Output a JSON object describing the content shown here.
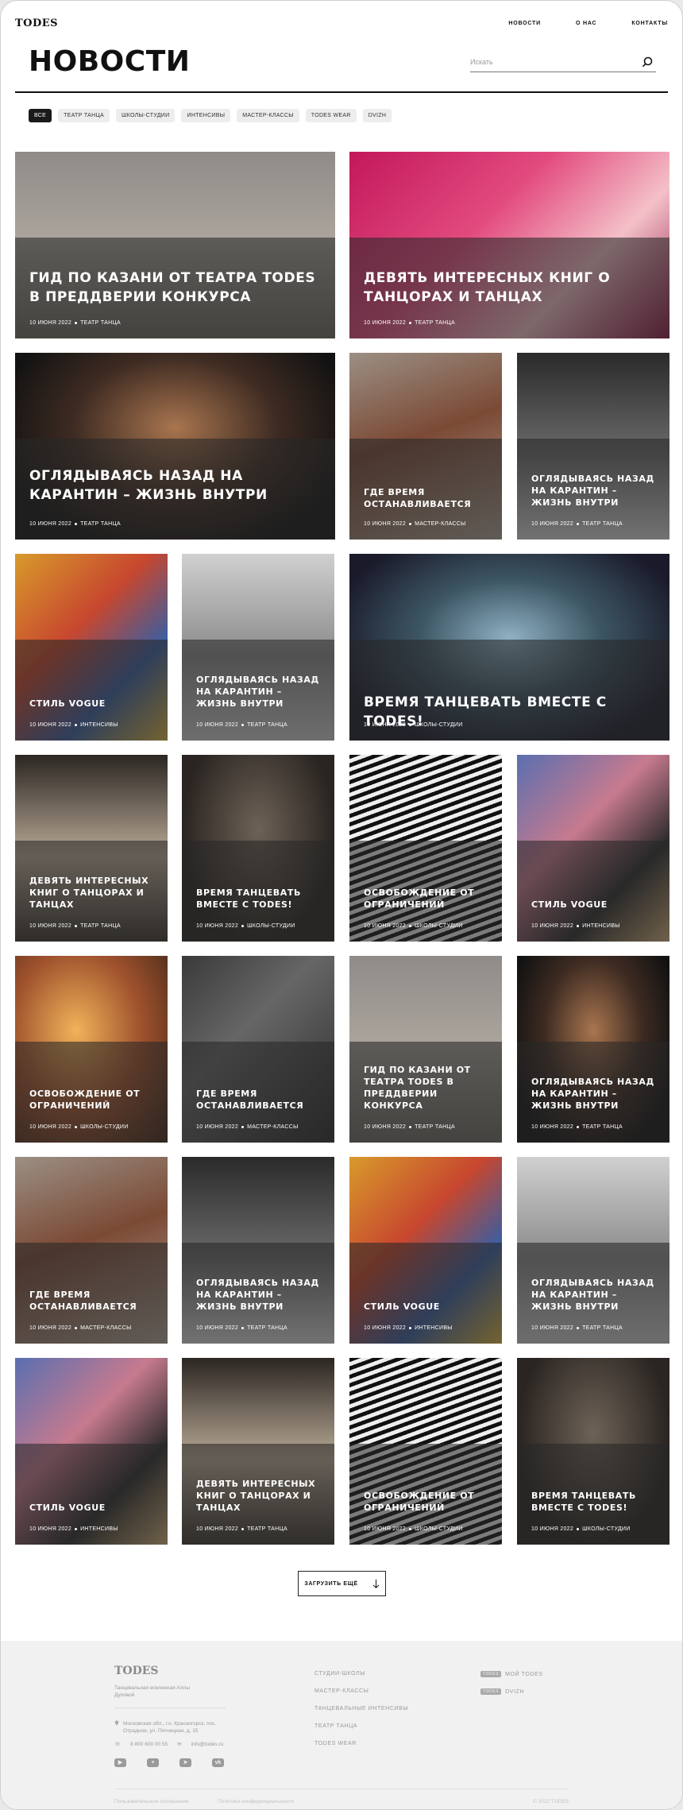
{
  "header": {
    "logo": "TODES",
    "nav": [
      "НОВОСТИ",
      "О НАС",
      "КОНТАКТЫ"
    ]
  },
  "page": {
    "title": "НОВОСТИ",
    "search_placeholder": "Искать"
  },
  "filters": [
    "ВСЕ",
    "ТЕАТР ТАНЦА",
    "ШКОЛЫ-СТУДИИ",
    "ИНТЕНСИВЫ",
    "МАСТЕР-КЛАССЫ",
    "TODES WEAR",
    "DVIZH"
  ],
  "cards": [
    {
      "title": "ГИД ПО КАЗАНИ ОТ ТЕАТРА TODES В ПРЕДДВЕРИИ КОНКУРСА",
      "date": "10 ИЮНЯ 2022",
      "category": "ТЕАТР ТАНЦА"
    },
    {
      "title": "ДЕВЯТЬ ИНТЕРЕСНЫХ КНИГ О ТАНЦОРАХ И ТАНЦАХ",
      "date": "10 ИЮНЯ 2022",
      "category": "ТЕАТР ТАНЦА"
    },
    {
      "title": "ОГЛЯДЫВАЯСЬ НАЗАД НА КАРАНТИН – ЖИЗНЬ ВНУТРИ",
      "date": "10 ИЮНЯ 2022",
      "category": "ТЕАТР ТАНЦА"
    },
    {
      "title": "ГДЕ ВРЕМЯ ОСТАНАВЛИВАЕТСЯ",
      "date": "10 ИЮНЯ 2022",
      "category": "МАСТЕР-КЛАССЫ"
    },
    {
      "title": "ОГЛЯДЫВАЯСЬ НАЗАД НА КАРАНТИН – ЖИЗНЬ ВНУТРИ",
      "date": "10 ИЮНЯ 2022",
      "category": "ТЕАТР ТАНЦА"
    },
    {
      "title": "СТИЛЬ VOGUE",
      "date": "10 ИЮНЯ 2022",
      "category": "ИНТЕНСИВЫ"
    },
    {
      "title": "ОГЛЯДЫВАЯСЬ НАЗАД НА КАРАНТИН – ЖИЗНЬ ВНУТРИ",
      "date": "10 ИЮНЯ 2022",
      "category": "ТЕАТР ТАНЦА"
    },
    {
      "title": "ВРЕМЯ ТАНЦЕВАТЬ ВМЕСТЕ С TODES!",
      "date": "10 ИЮНЯ 2022",
      "category": "ШКОЛЫ-СТУДИИ"
    },
    {
      "title": "ДЕВЯТЬ ИНТЕРЕСНЫХ КНИГ О ТАНЦОРАХ И ТАНЦАХ",
      "date": "10 ИЮНЯ 2022",
      "category": "ТЕАТР ТАНЦА"
    },
    {
      "title": "ВРЕМЯ ТАНЦЕВАТЬ ВМЕСТЕ С TODES!",
      "date": "10 ИЮНЯ 2022",
      "category": "ШКОЛЫ-СТУДИИ"
    },
    {
      "title": "ОСВОБОЖДЕНИЕ ОТ ОГРАНИЧЕНИЙ",
      "date": "10 ИЮНЯ 2022",
      "category": "ШКОЛЫ-СТУДИИ"
    },
    {
      "title": "СТИЛЬ VOGUE",
      "date": "10 ИЮНЯ 2022",
      "category": "ИНТЕНСИВЫ"
    },
    {
      "title": "ОСВОБОЖДЕНИЕ ОТ ОГРАНИЧЕНИЙ",
      "date": "10 ИЮНЯ 2022",
      "category": "ШКОЛЫ-СТУДИИ"
    },
    {
      "title": "ГДЕ ВРЕМЯ ОСТАНАВЛИВАЕТСЯ",
      "date": "10 ИЮНЯ 2022",
      "category": "МАСТЕР-КЛАССЫ"
    },
    {
      "title": "ГИД ПО КАЗАНИ ОТ ТЕАТРА TODES В ПРЕДДВЕРИИ КОНКУРСА",
      "date": "10 ИЮНЯ 2022",
      "category": "ТЕАТР ТАНЦА"
    },
    {
      "title": "ОГЛЯДЫВАЯСЬ НАЗАД НА КАРАНТИН – ЖИЗНЬ ВНУТРИ",
      "date": "10 ИЮНЯ 2022",
      "category": "ТЕАТР ТАНЦА"
    },
    {
      "title": "ГДЕ ВРЕМЯ ОСТАНАВЛИВАЕТСЯ",
      "date": "10 ИЮНЯ 2022",
      "category": "МАСТЕР-КЛАССЫ"
    },
    {
      "title": "ОГЛЯДЫВАЯСЬ НАЗАД НА КАРАНТИН – ЖИЗНЬ ВНУТРИ",
      "date": "10 ИЮНЯ 2022",
      "category": "ТЕАТР ТАНЦА"
    },
    {
      "title": "СТИЛЬ VOGUE",
      "date": "10 ИЮНЯ 2022",
      "category": "ИНТЕНСИВЫ"
    },
    {
      "title": "ОГЛЯДЫВАЯСЬ НАЗАД НА КАРАНТИН – ЖИЗНЬ ВНУТРИ",
      "date": "10 ИЮНЯ 2022",
      "category": "ТЕАТР ТАНЦА"
    },
    {
      "title": "СТИЛЬ VOGUE",
      "date": "10 ИЮНЯ 2022",
      "category": "ИНТЕНСИВЫ"
    },
    {
      "title": "ДЕВЯТЬ ИНТЕРЕСНЫХ КНИГ О ТАНЦОРАХ И ТАНЦАХ",
      "date": "10 ИЮНЯ 2022",
      "category": "ТЕАТР ТАНЦА"
    },
    {
      "title": "ОСВОБОЖДЕНИЕ ОТ ОГРАНИЧЕНИЙ",
      "date": "10 ИЮНЯ 2022",
      "category": "ШКОЛЫ-СТУДИИ"
    },
    {
      "title": "ВРЕМЯ ТАНЦЕВАТЬ ВМЕСТЕ С TODES!",
      "date": "10 ИЮНЯ 2022",
      "category": "ШКОЛЫ-СТУДИИ"
    }
  ],
  "load_more": "ЗАГРУЗИТЬ ЕЩЁ",
  "footer": {
    "logo": "TODES",
    "tagline": "Танцевальная вселенная Аллы Духовой",
    "address": "Московская обл., г.о. Красногорск, пос. Отрадное, ул. Пятницкая, д. 15",
    "phone": "8 800 600 00 55",
    "email": "info@todes.ru",
    "links": [
      "СТУДИИ-ШКОЛЫ",
      "МАСТЕР-КЛАССЫ",
      "ТАНЦЕВАЛЬНЫЕ ИНТЕНСИВЫ",
      "ТЕАТР ТАНЦА",
      "TODES WEAR"
    ],
    "apps": [
      {
        "tag": "TODES",
        "label": "МОЙ TODES"
      },
      {
        "tag": "TODES",
        "label": "DVIZH"
      }
    ],
    "legal_left": "Пользовательское соглашение",
    "legal_mid": "Политика конфиденциальности",
    "copyright": "© 2022 TODES"
  }
}
